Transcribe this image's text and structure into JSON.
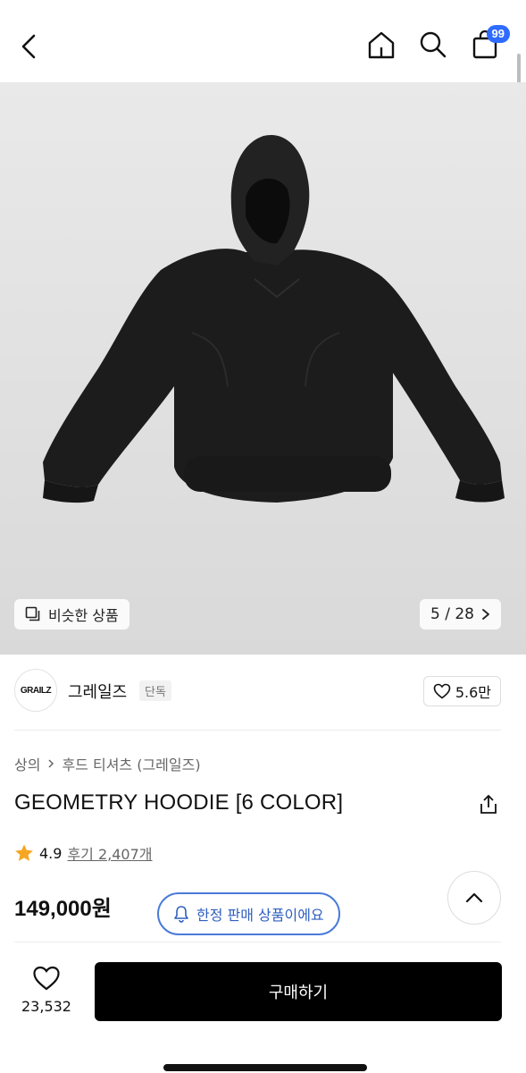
{
  "header": {
    "back_icon": "chevron-left-icon",
    "home_icon": "home-icon",
    "search_icon": "search-icon",
    "cart_icon": "shopping-bag-icon",
    "cart_count": "99",
    "badge_color": "#2f6bff"
  },
  "gallery": {
    "similar_label": "비슷한 상품",
    "similar_icon": "similar-items-icon",
    "page_indicator": "5 / 28",
    "next_icon": "chevron-right-icon"
  },
  "brand": {
    "logo_text": "GRAILZ",
    "name": "그레일즈",
    "tag": "단독",
    "likes": "5.6만",
    "like_icon": "heart-icon"
  },
  "product": {
    "category_1": "상의",
    "category_2": "후드 티셔츠 (그레일즈)",
    "title": "GEOMETRY HOODIE [6 COLOR]",
    "rating": "4.9",
    "reviews": "후기 2,407개",
    "price": "149,000원",
    "limited_label": "한정 판매 상품이에요",
    "accent_color": "#4a7bd8",
    "star_color": "#f5a623"
  },
  "bottom": {
    "wish_count": "23,532",
    "buy_label": "구매하기"
  }
}
